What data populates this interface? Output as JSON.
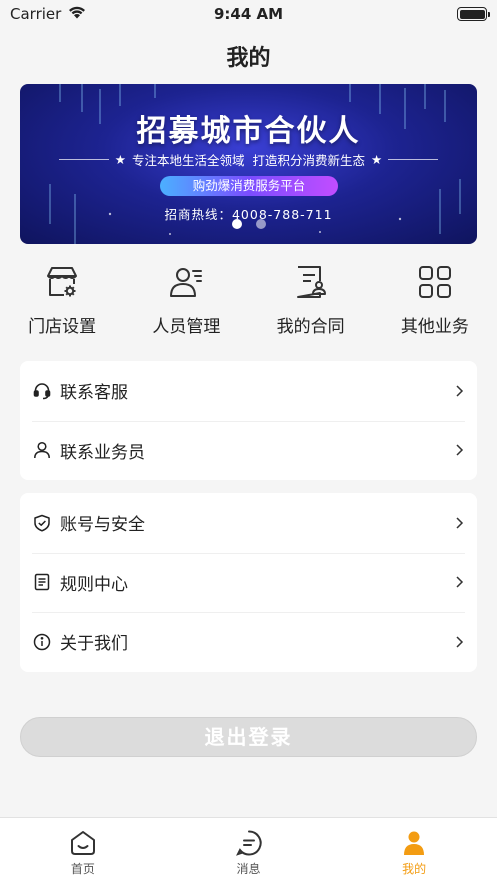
{
  "status_bar": {
    "carrier": "Carrier",
    "time": "9:44 AM"
  },
  "nav": {
    "title": "我的"
  },
  "banner": {
    "title": "招募城市合伙人",
    "subtitle": "专注本地生活全领域  打造积分消费新生态",
    "pill": "购劲爆消费服务平台",
    "hotline": "招商热线：4008-788-711",
    "slide_count": 2,
    "active_slide": 0
  },
  "quick_actions": [
    {
      "label": "门店设置",
      "icon": "store-settings-icon"
    },
    {
      "label": "人员管理",
      "icon": "user-list-icon"
    },
    {
      "label": "我的合同",
      "icon": "contract-icon"
    },
    {
      "label": "其他业务",
      "icon": "grid-apps-icon"
    }
  ],
  "menu_group_1": [
    {
      "label": "联系客服",
      "icon": "headset-icon"
    },
    {
      "label": "联系业务员",
      "icon": "person-icon"
    }
  ],
  "menu_group_2": [
    {
      "label": "账号与安全",
      "icon": "shield-check-icon"
    },
    {
      "label": "规则中心",
      "icon": "document-icon"
    },
    {
      "label": "关于我们",
      "icon": "info-icon"
    }
  ],
  "logout": {
    "label": "退出登录"
  },
  "tab_bar": [
    {
      "label": "首页",
      "icon": "home-face-icon",
      "active": false
    },
    {
      "label": "消息",
      "icon": "message-icon",
      "active": false
    },
    {
      "label": "我的",
      "icon": "profile-icon",
      "active": true
    }
  ],
  "colors": {
    "accent": "#f39c12",
    "banner_deep": "#1d2391",
    "logout_disabled": "#dcdcdc"
  }
}
